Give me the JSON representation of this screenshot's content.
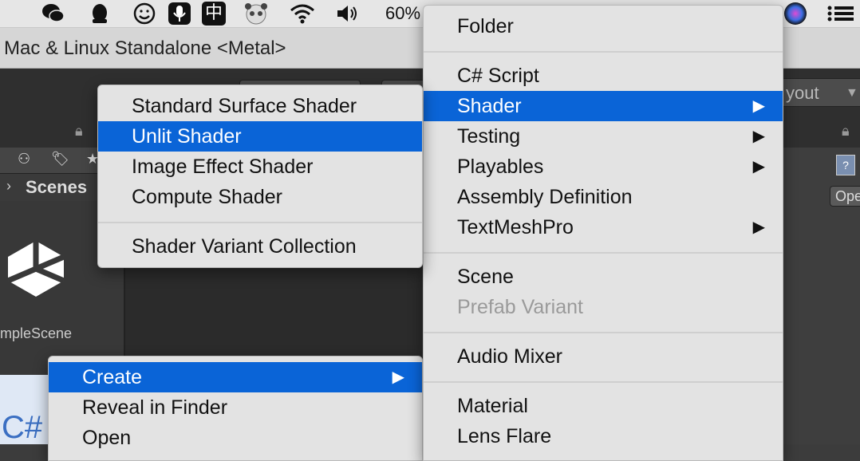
{
  "menubar": {
    "icons": [
      "wechat-icon",
      "qq-icon",
      "emoji-icon",
      "microphone-icon",
      "input-method-icon",
      "panda-icon",
      "wifi-icon",
      "volume-icon",
      "siri-icon",
      "control-center-icon"
    ],
    "input_method_label": "中",
    "battery_text": "60%"
  },
  "window": {
    "title": "Mac & Linux Standalone <Metal>"
  },
  "toolbar": {
    "layout_label": "yout"
  },
  "project": {
    "breadcrumb": "Scenes",
    "scene_name": "mpleScene",
    "file_label": "C#"
  },
  "inspector": {
    "open_label": "Ope"
  },
  "context_menu": {
    "items": [
      {
        "label": "Create",
        "selected": true,
        "submenu": true
      },
      {
        "label": "Reveal in Finder"
      },
      {
        "label": "Open"
      }
    ]
  },
  "create_menu": {
    "items": [
      {
        "label": "Folder"
      },
      {
        "label": "C# Script"
      },
      {
        "label": "Shader",
        "selected": true,
        "submenu": true
      },
      {
        "label": "Testing",
        "submenu": true
      },
      {
        "label": "Playables",
        "submenu": true
      },
      {
        "label": "Assembly Definition"
      },
      {
        "label": "TextMeshPro",
        "submenu": true
      },
      {
        "label": "Scene"
      },
      {
        "label": "Prefab Variant",
        "disabled": true
      },
      {
        "label": "Audio Mixer"
      },
      {
        "label": "Material"
      },
      {
        "label": "Lens Flare"
      }
    ]
  },
  "shader_menu": {
    "items": [
      {
        "label": "Standard Surface Shader"
      },
      {
        "label": "Unlit Shader",
        "selected": true
      },
      {
        "label": "Image Effect Shader"
      },
      {
        "label": "Compute Shader"
      },
      {
        "label": "Shader Variant Collection"
      }
    ]
  },
  "colors": {
    "selection": "#0a64d7",
    "menu_bg": "#e3e3e3",
    "unity_dark": "#2b2b2b"
  }
}
